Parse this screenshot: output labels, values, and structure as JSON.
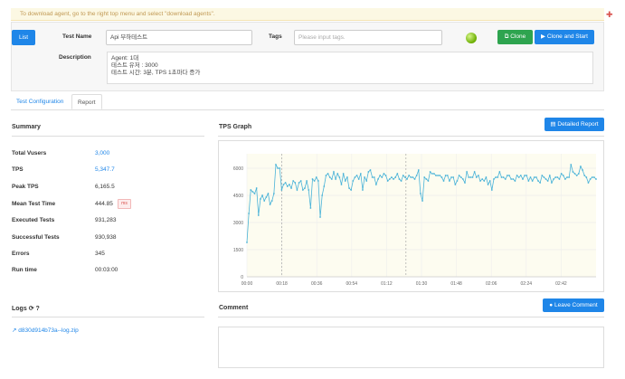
{
  "notice": {
    "text": "To download agent, go to the right top menu and select \"download agents\"."
  },
  "top": {
    "list_label": "List",
    "test_name_label": "Test Name",
    "test_name_value": "Api 부하테스트",
    "tags_label": "Tags",
    "tags_placeholder": "Please input tags.",
    "clone_label": "Clone",
    "clone_start_label": "Clone and Start",
    "description_label": "Description",
    "description_lines": [
      "Agent: 1대",
      "테스트 유저 : 3000",
      "테스트 시간: 3분,          TPS 1초마다 증가"
    ]
  },
  "tabs": {
    "config": "Test Configuration",
    "report": "Report"
  },
  "summary": {
    "title": "Summary",
    "rows": [
      {
        "label": "Total Vusers",
        "value": "3,000",
        "link": true
      },
      {
        "label": "TPS",
        "value": "5,347.7",
        "link": true
      },
      {
        "label": "Peak TPS",
        "value": "6,165.5",
        "link": false
      },
      {
        "label": "Mean Test Time",
        "value": "444.85",
        "link": false
      },
      {
        "label": "Executed Tests",
        "value": "931,283",
        "link": false
      },
      {
        "label": "Successful Tests",
        "value": "930,938",
        "link": false
      },
      {
        "label": "Errors",
        "value": "345",
        "link": false
      },
      {
        "label": "Run time",
        "value": "00:03:00",
        "link": false
      }
    ],
    "unit_badge": "ms"
  },
  "graph": {
    "title": "TPS Graph",
    "detailed_report_label": "Detailed Report"
  },
  "logs": {
    "title": "Logs",
    "file": "d830d914b73a--log.zip"
  },
  "comment": {
    "title": "Comment",
    "leave_comment_label": "Leave Comment"
  },
  "colors": {
    "primary": "#1f86e8",
    "success": "#2ea44f",
    "line": "#4ab3d8",
    "plot_bg": "#fdfcf0"
  },
  "chart_data": {
    "type": "line",
    "title": "",
    "xlabel": "",
    "ylabel": "",
    "x_ticks": [
      "00:00",
      "00:18",
      "00:36",
      "00:54",
      "01:12",
      "01:30",
      "01:48",
      "02:06",
      "02:24",
      "02:42"
    ],
    "y_ticks": [
      0,
      1500,
      3000,
      4500,
      6000
    ],
    "ylim": [
      0,
      6800
    ],
    "xlim": [
      0,
      180
    ],
    "grid": true,
    "series": [
      {
        "values": [
          1900,
          3500,
          4800,
          4700,
          4600,
          4900,
          3400,
          4300,
          4500,
          4200,
          4400,
          4600,
          4000,
          4200,
          4600,
          6200,
          6000,
          6000,
          4800,
          5100,
          5200,
          5000,
          5100,
          4900,
          5300,
          5200,
          4800,
          5200,
          5300,
          4800,
          4900,
          5300,
          4800,
          3800,
          5400,
          5300,
          5500,
          5300,
          3300,
          4500,
          5000,
          5600,
          5700,
          5500,
          5400,
          5800,
          5400,
          5700,
          5500,
          5100,
          5700,
          5300,
          5500,
          4900,
          4800,
          5300,
          5500,
          5600,
          5400,
          5700,
          4800,
          5500,
          5300,
          5800,
          5900,
          5500,
          5500,
          5100,
          5400,
          5600,
          5500,
          5700,
          5600,
          5300,
          5400,
          5500,
          5400,
          5500,
          5700,
          5400,
          5300,
          5600,
          5500,
          5400,
          5600,
          5500,
          5500,
          5400,
          5600,
          5900,
          4600,
          4200,
          5500,
          5400,
          5300,
          5800,
          5700,
          5700,
          5600,
          5600,
          5600,
          5500,
          5300,
          5600,
          5600,
          5300,
          5500,
          5500,
          5100,
          5300,
          5600,
          5500,
          5400,
          5200,
          5800,
          5500,
          5500,
          5500,
          5800,
          5500,
          5600,
          5300,
          5400,
          5300,
          5500,
          5100,
          5300,
          4800,
          5400,
          5500,
          5500,
          5800,
          5500,
          5500,
          5400,
          5600,
          5600,
          5400,
          5400,
          5300,
          5600,
          5500,
          5600,
          5400,
          5600,
          5600,
          5300,
          5500,
          5300,
          5500,
          5500,
          5300,
          5200,
          5600,
          5500,
          5400,
          5300,
          5600,
          5200,
          5400,
          5500,
          5500,
          5400,
          5700,
          5600,
          5400,
          5500,
          5500,
          6200,
          5800,
          5700,
          5600,
          5700,
          6100,
          5900,
          5600,
          5500,
          5200,
          5400,
          5500,
          5500,
          5400
        ]
      }
    ],
    "markers": [
      18,
      82
    ]
  }
}
